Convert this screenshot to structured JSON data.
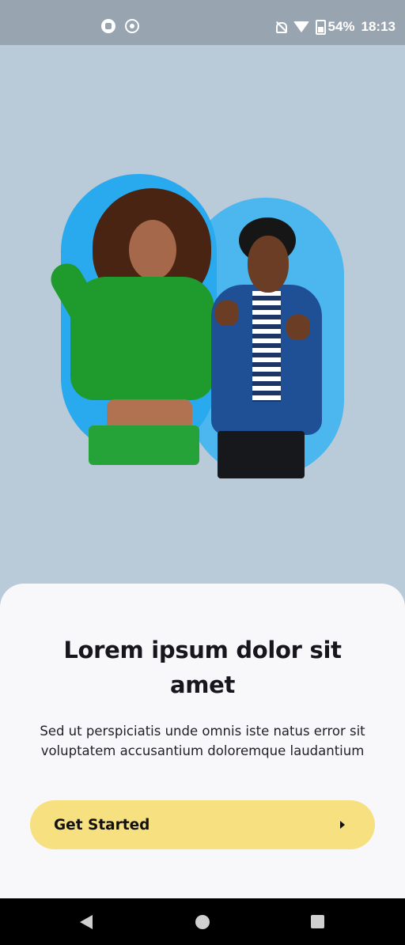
{
  "status_bar": {
    "battery": "54%",
    "time": "18:13",
    "icons": [
      "app-notification-icon",
      "screen-record-icon",
      "notifications-off-icon",
      "wifi-icon",
      "battery-icon"
    ]
  },
  "onboarding": {
    "title": "Lorem ipsum dolor sit amet",
    "description": "Sed ut perspiciatis unde omnis iste natus error sit voluptatem accusantium doloremque laudantium",
    "cta_label": "Get Started",
    "cta_icon": "chevron-right-icon"
  },
  "colors": {
    "background": "#b9cad9",
    "sheet": "#f8f8fb",
    "cta": "#f6e07f",
    "pill": "#2aaaee"
  },
  "nav_bar": {
    "icons": [
      "back-icon",
      "home-icon",
      "recents-icon"
    ]
  }
}
